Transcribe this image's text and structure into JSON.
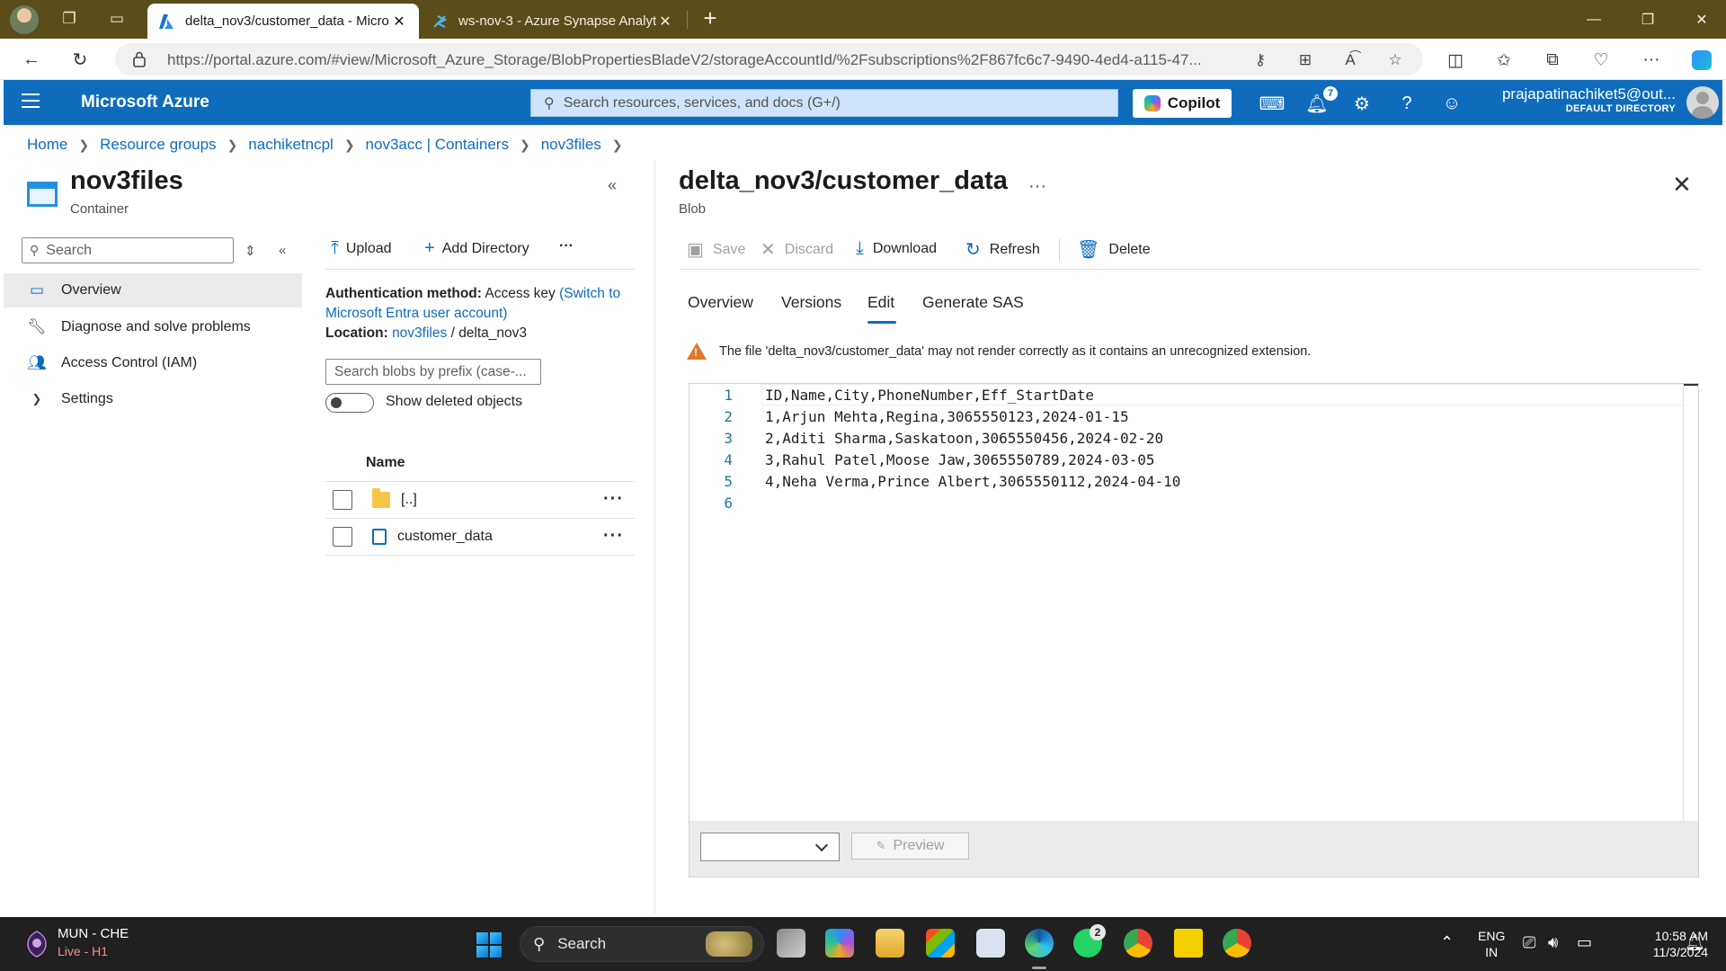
{
  "browser": {
    "tabs": [
      {
        "title": "delta_nov3/customer_data - Micro",
        "active": true
      },
      {
        "title": "ws-nov-3 - Azure Synapse Analyti",
        "active": false
      }
    ],
    "new_tab": "+",
    "url": "https://portal.azure.com/#view/Microsoft_Azure_Storage/BlobPropertiesBladeV2/storageAccountId/%2Fsubscriptions%2F867fc6c7-9490-4ed4-a115-47..."
  },
  "portal": {
    "brand": "Microsoft Azure",
    "search_placeholder": "Search resources, services, and docs (G+/)",
    "copilot_label": "Copilot",
    "notification_count": "7",
    "user_email": "prajapatinachiket5@out...",
    "user_directory": "DEFAULT DIRECTORY"
  },
  "breadcrumb": [
    "Home",
    "Resource groups",
    "nachiketncpl",
    "nov3acc | Containers",
    "nov3files"
  ],
  "resource": {
    "title": "nov3files",
    "subtitle": "Container",
    "search_placeholder": "Search",
    "menu": [
      {
        "label": "Overview",
        "icon": "container-icon",
        "selected": true
      },
      {
        "label": "Diagnose and solve problems",
        "icon": "wrench-icon",
        "selected": false
      },
      {
        "label": "Access Control (IAM)",
        "icon": "people-icon",
        "selected": false
      },
      {
        "label": "Settings",
        "icon": "chevron-right-icon",
        "selected": false
      }
    ]
  },
  "container": {
    "commands": {
      "upload": "Upload",
      "add_directory": "Add Directory",
      "more": "···"
    },
    "auth_label": "Authentication method:",
    "auth_value": "Access key",
    "auth_link": "(Switch to Microsoft Entra user account)",
    "location_label": "Location:",
    "location_link": "nov3files",
    "location_sep": "/",
    "location_path": "delta_nov3",
    "prefix_placeholder": "Search blobs by prefix (case-...",
    "show_deleted_label": "Show deleted objects",
    "show_deleted_on": false,
    "column_name": "Name",
    "rows": [
      {
        "name": "[..]",
        "type": "folder"
      },
      {
        "name": "customer_data",
        "type": "file"
      }
    ]
  },
  "blob": {
    "title": "delta_nov3/customer_data",
    "subtitle": "Blob",
    "commands": {
      "save": "Save",
      "discard": "Discard",
      "download": "Download",
      "refresh": "Refresh",
      "delete": "Delete"
    },
    "tabs": [
      "Overview",
      "Versions",
      "Edit",
      "Generate SAS"
    ],
    "selected_tab": "Edit",
    "warning": "The file 'delta_nov3/customer_data' may not render correctly as it contains an unrecognized extension.",
    "editor_lines": [
      {
        "n": "1",
        "text": "ID,Name,City,PhoneNumber,Eff_StartDate"
      },
      {
        "n": "2",
        "text": "1,Arjun Mehta,Regina,3065550123,2024-01-15"
      },
      {
        "n": "3",
        "text": "2,Aditi Sharma,Saskatoon,3065550456,2024-02-20"
      },
      {
        "n": "4",
        "text": "3,Rahul Patel,Moose Jaw,3065550789,2024-03-05"
      },
      {
        "n": "5",
        "text": "4,Neha Verma,Prince Albert,3065550112,2024-04-10"
      },
      {
        "n": "6",
        "text": ""
      }
    ],
    "preview_label": "Preview"
  },
  "taskbar": {
    "team_line1": "MUN - CHE",
    "team_line2": "Live - H1",
    "search_label": "Search",
    "whatsapp_badge": "2",
    "lang_line1": "ENG",
    "lang_line2": "IN",
    "time": "10:58 AM",
    "date": "11/3/2024"
  },
  "colors": {
    "azure_blue": "#0f6cbd",
    "tabstrip": "#5a4d19",
    "warning": "#e3782a",
    "taskbar": "#202020"
  }
}
